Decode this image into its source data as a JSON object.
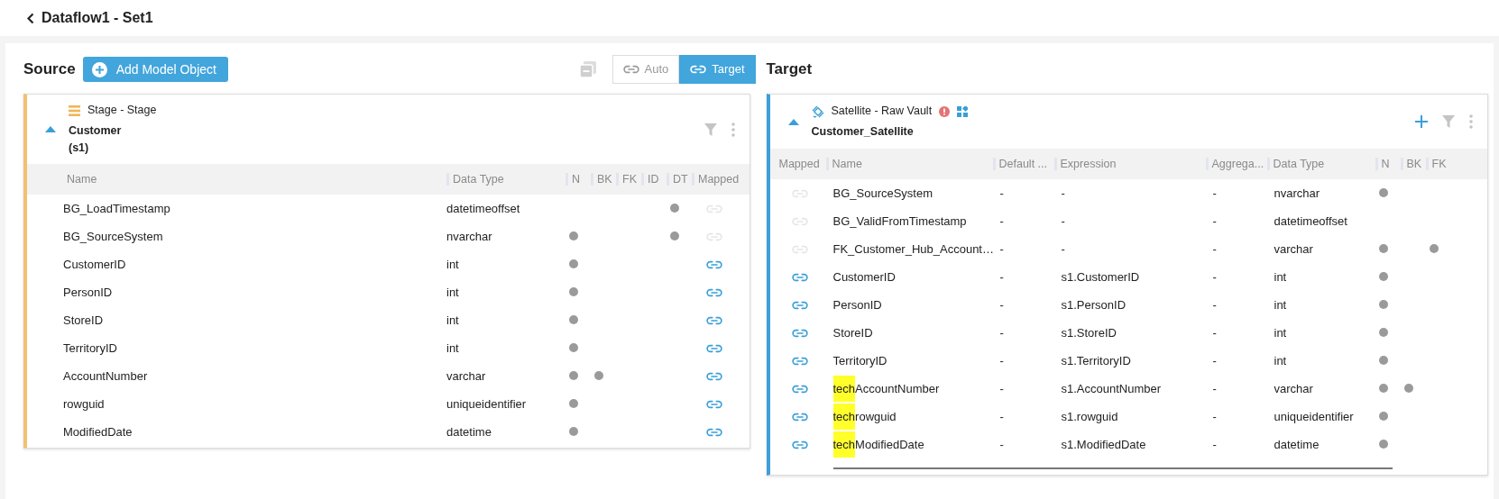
{
  "header": {
    "title": "Dataflow1 - Set1"
  },
  "source": {
    "heading": "Source",
    "add_button": "Add Model Object",
    "mode_toggle": [
      {
        "label": "Auto",
        "selected": false
      },
      {
        "label": "Target",
        "selected": true
      }
    ],
    "object": {
      "type": "Stage - Stage",
      "name": "Customer",
      "alias": "(s1)",
      "expanded": true
    },
    "columns": [
      "Name",
      "Data Type",
      "N",
      "BK",
      "FK",
      "ID",
      "DT",
      "Mapped"
    ],
    "rows": [
      {
        "name": "BG_LoadTimestamp",
        "data_type": "datetimeoffset",
        "n": false,
        "bk": false,
        "fk": false,
        "id": false,
        "dt": true,
        "mapped": false
      },
      {
        "name": "BG_SourceSystem",
        "data_type": "nvarchar",
        "n": true,
        "bk": false,
        "fk": false,
        "id": false,
        "dt": true,
        "mapped": false
      },
      {
        "name": "CustomerID",
        "data_type": "int",
        "n": true,
        "bk": false,
        "fk": false,
        "id": false,
        "dt": false,
        "mapped": true
      },
      {
        "name": "PersonID",
        "data_type": "int",
        "n": true,
        "bk": false,
        "fk": false,
        "id": false,
        "dt": false,
        "mapped": true
      },
      {
        "name": "StoreID",
        "data_type": "int",
        "n": true,
        "bk": false,
        "fk": false,
        "id": false,
        "dt": false,
        "mapped": true
      },
      {
        "name": "TerritoryID",
        "data_type": "int",
        "n": true,
        "bk": false,
        "fk": false,
        "id": false,
        "dt": false,
        "mapped": true
      },
      {
        "name": "AccountNumber",
        "data_type": "varchar",
        "n": true,
        "bk": true,
        "fk": false,
        "id": false,
        "dt": false,
        "mapped": true
      },
      {
        "name": "rowguid",
        "data_type": "uniqueidentifier",
        "n": true,
        "bk": false,
        "fk": false,
        "id": false,
        "dt": false,
        "mapped": true
      },
      {
        "name": "ModifiedDate",
        "data_type": "datetime",
        "n": true,
        "bk": false,
        "fk": false,
        "id": false,
        "dt": false,
        "mapped": true
      }
    ]
  },
  "target": {
    "heading": "Target",
    "object": {
      "type": "Satellite - Raw Vault",
      "name": "Customer_Satellite",
      "expanded": true
    },
    "columns": [
      "Mapped",
      "Name",
      "Default ...",
      "Expression",
      "Aggrega...",
      "Data Type",
      "N",
      "BK",
      "FK"
    ],
    "rows": [
      {
        "mapped": false,
        "name": "BG_SourceSystem",
        "default": "-",
        "expression": "-",
        "aggregation": "-",
        "data_type": "nvarchar",
        "n": true,
        "bk": false,
        "fk": false
      },
      {
        "mapped": false,
        "name": "BG_ValidFromTimestamp",
        "default": "-",
        "expression": "-",
        "aggregation": "-",
        "data_type": "datetimeoffset",
        "n": false,
        "bk": false,
        "fk": false
      },
      {
        "mapped": false,
        "name": "FK_Customer_Hub_Account…",
        "default": "-",
        "expression": "-",
        "aggregation": "-",
        "data_type": "varchar",
        "n": true,
        "bk": false,
        "fk": true
      },
      {
        "mapped": true,
        "name": "CustomerID",
        "default": "-",
        "expression": "s1.CustomerID",
        "aggregation": "-",
        "data_type": "int",
        "n": true,
        "bk": false,
        "fk": false
      },
      {
        "mapped": true,
        "name": "PersonID",
        "default": "-",
        "expression": "s1.PersonID",
        "aggregation": "-",
        "data_type": "int",
        "n": true,
        "bk": false,
        "fk": false
      },
      {
        "mapped": true,
        "name": "StoreID",
        "default": "-",
        "expression": "s1.StoreID",
        "aggregation": "-",
        "data_type": "int",
        "n": true,
        "bk": false,
        "fk": false
      },
      {
        "mapped": true,
        "name": "TerritoryID",
        "default": "-",
        "expression": "s1.TerritoryID",
        "aggregation": "-",
        "data_type": "int",
        "n": true,
        "bk": false,
        "fk": false
      },
      {
        "mapped": true,
        "highlight": "tech",
        "name": "AccountNumber",
        "default": "-",
        "expression": "s1.AccountNumber",
        "aggregation": "-",
        "data_type": "varchar",
        "n": true,
        "bk": true,
        "fk": false
      },
      {
        "mapped": true,
        "highlight": "tech",
        "name": "rowguid",
        "default": "-",
        "expression": "s1.rowguid",
        "aggregation": "-",
        "data_type": "uniqueidentifier",
        "n": true,
        "bk": false,
        "fk": false
      },
      {
        "mapped": true,
        "highlight": "tech",
        "name": "ModifiedDate",
        "default": "-",
        "expression": "s1.ModifiedDate",
        "aggregation": "-",
        "data_type": "datetime",
        "n": true,
        "bk": false,
        "fk": false
      }
    ]
  }
}
